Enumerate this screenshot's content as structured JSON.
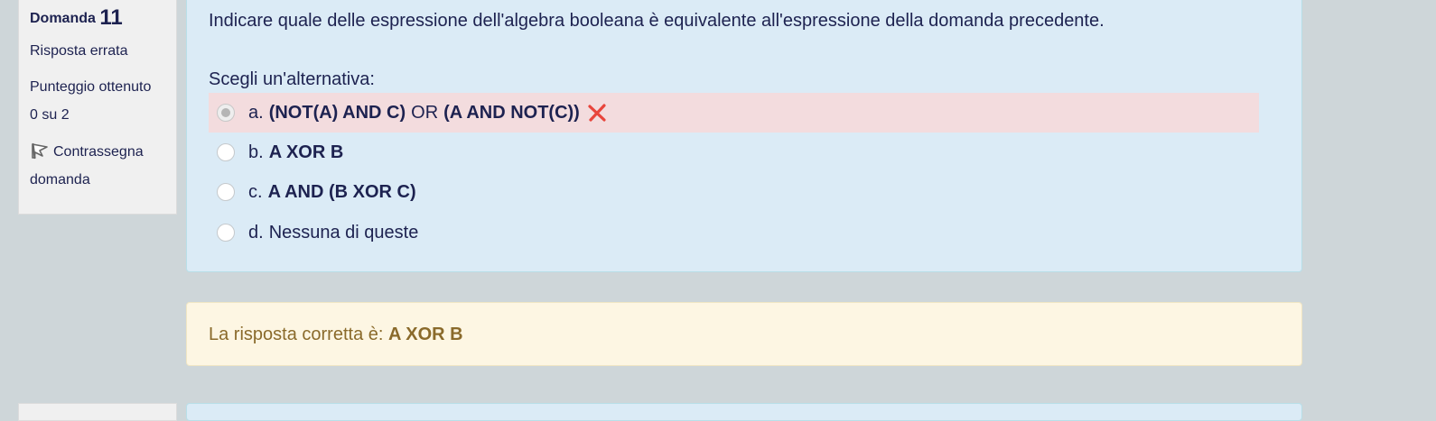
{
  "info": {
    "question_label": "Domanda",
    "question_number": "11",
    "state": "Risposta errata",
    "grade_line1": "Punteggio ottenuto",
    "grade_line2": "0 su 2",
    "flag_line1": "Contrassegna",
    "flag_line2": "domanda"
  },
  "question": {
    "text": "Indicare quale delle espressione dell'algebra booleana è equivalente all'espressione della domanda precedente.",
    "prompt": "Scegli un'alternativa:"
  },
  "options": [
    {
      "letter": "a.",
      "part1": "(NOT(A) AND C)",
      "part2": "OR",
      "part3": "(A AND NOT(C))",
      "selected": true,
      "status": "incorrect"
    },
    {
      "letter": "b.",
      "text": "A XOR B",
      "selected": false
    },
    {
      "letter": "c.",
      "text": "A AND (B XOR C)",
      "selected": false
    },
    {
      "letter": "d.",
      "text": "Nessuna di queste",
      "selected": false
    }
  ],
  "feedback": {
    "label": "La risposta corretta è:",
    "answer": "A XOR B"
  },
  "icons": {
    "flag": "flag-icon",
    "incorrect": "cross-icon"
  },
  "colors": {
    "background": "#ced6d9",
    "question_bg": "#dbebf6",
    "incorrect_bg": "#f3dcde",
    "feedback_bg": "#fdf6e3",
    "feedback_text": "#8a6a2b",
    "cross": "#e8453c"
  }
}
